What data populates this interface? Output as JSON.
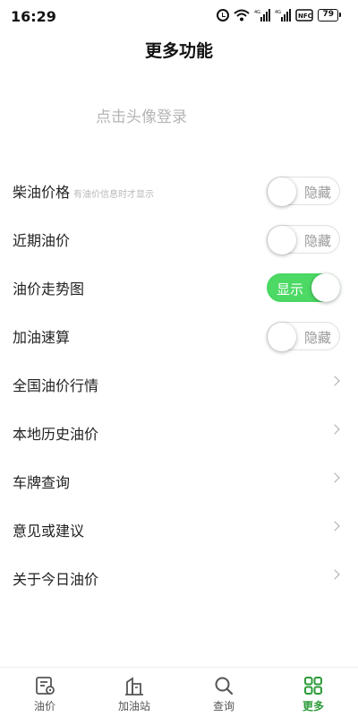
{
  "status_bar": {
    "time": "16:29",
    "battery": "79",
    "signal_1": "4G",
    "signal_2": "4G",
    "nfc": "NFC"
  },
  "header": {
    "title": "更多功能"
  },
  "login": {
    "text": "点击头像登录"
  },
  "settings": [
    {
      "label": "柴油价格",
      "hint": "有油价信息时才显示",
      "state": "隐藏",
      "on": false
    },
    {
      "label": "近期油价",
      "state": "隐藏",
      "on": false
    },
    {
      "label": "油价走势图",
      "state": "显示",
      "on": true
    },
    {
      "label": "加油速算",
      "state": "隐藏",
      "on": false
    }
  ],
  "links": [
    {
      "label": "全国油价行情"
    },
    {
      "label": "本地历史油价"
    },
    {
      "label": "车牌查询"
    },
    {
      "label": "意见或建议"
    },
    {
      "label": "关于今日油价"
    }
  ],
  "tabs": [
    {
      "label": "油价",
      "icon": "fuel-price-icon",
      "active": false
    },
    {
      "label": "加油站",
      "icon": "gas-station-icon",
      "active": false
    },
    {
      "label": "查询",
      "icon": "search-icon",
      "active": false
    },
    {
      "label": "更多",
      "icon": "grid-more-icon",
      "active": true
    }
  ],
  "colors": {
    "accent": "#2e9b3a",
    "toggle_on": "#4cd964",
    "muted": "#b5b5b5"
  }
}
